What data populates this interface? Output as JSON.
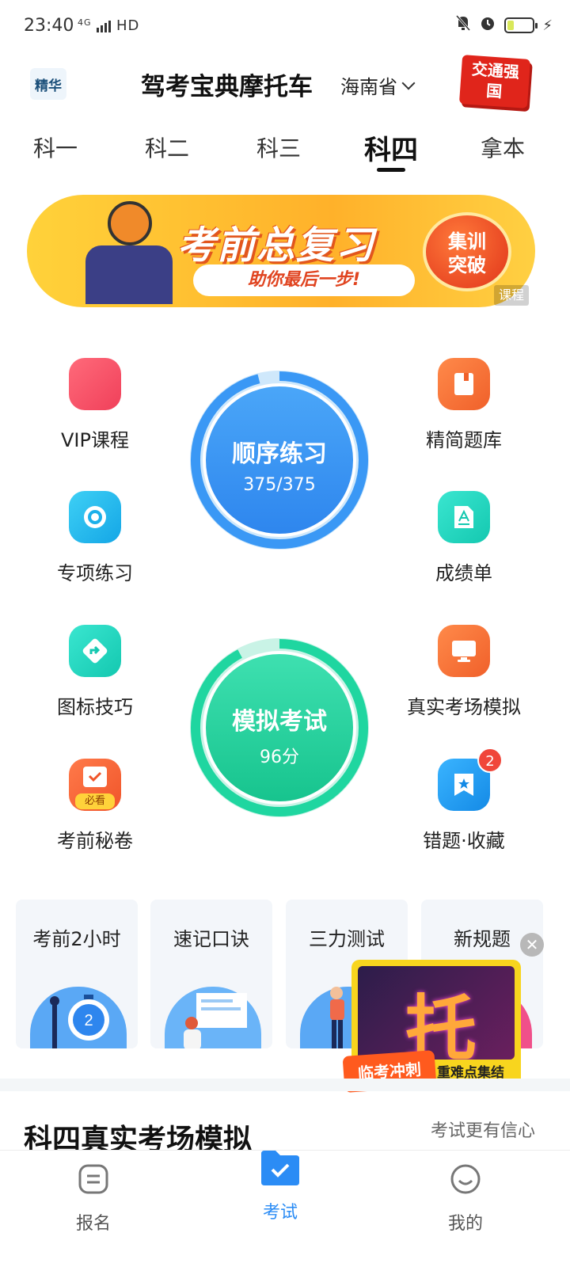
{
  "status_bar": {
    "time": "23:40",
    "network": "4G",
    "hd": "HD",
    "icons": [
      "mute-icon",
      "alarm-icon",
      "battery-icon",
      "charging-icon"
    ]
  },
  "header": {
    "logo_text": "精华",
    "title": "驾考宝典摩托车",
    "province": "海南省",
    "badge_text": "交通强国"
  },
  "tabs": [
    {
      "label": "科一",
      "active": false
    },
    {
      "label": "科二",
      "active": false
    },
    {
      "label": "科三",
      "active": false
    },
    {
      "label": "科四",
      "active": true
    },
    {
      "label": "拿本",
      "active": false
    }
  ],
  "banner": {
    "title": "考前总复习",
    "subtitle": "助你最后一步!",
    "cta": "集训突破",
    "tag": "课程"
  },
  "left_items": [
    {
      "label": "VIP课程",
      "icon": "vip-icon",
      "color": "#f04a5e"
    },
    {
      "label": "专项练习",
      "icon": "target-icon",
      "color": "#1cb0ea"
    },
    {
      "label": "图标技巧",
      "icon": "direction-sign-icon",
      "color": "#1fd6c0"
    },
    {
      "label": "考前秘卷",
      "icon": "must-see-icon",
      "color": "#f5a623",
      "sub": "必看"
    }
  ],
  "right_items": [
    {
      "label": "精简题库",
      "icon": "book-icon",
      "color": "#f5733a"
    },
    {
      "label": "成绩单",
      "icon": "scorecard-icon",
      "color": "#1fd6c0"
    },
    {
      "label": "真实考场模拟",
      "icon": "monitor-icon",
      "color": "#f5733a"
    },
    {
      "label": "错题·收藏",
      "icon": "bookmark-star-icon",
      "color": "#1c9ff0",
      "badge": "2"
    }
  ],
  "practice": {
    "title": "顺序练习",
    "progress": "375/375",
    "done": 375,
    "total": 375
  },
  "mock_exam": {
    "title": "模拟考试",
    "score": "96分",
    "score_value": 96
  },
  "cards": [
    {
      "title": "考前2小时",
      "icon": "stopwatch-icon",
      "number": "2"
    },
    {
      "title": "速记口诀",
      "icon": "study-icon"
    },
    {
      "title": "三力测试",
      "icon": "person-icon"
    },
    {
      "title": "新规题",
      "icon": "new-rules-icon"
    }
  ],
  "promo": {
    "big_char": "托",
    "tag1": "临考冲刺",
    "tag2": "重难点集结"
  },
  "section": {
    "title": "科四真实考场模拟",
    "subtitle": "考试更有信心"
  },
  "bottom_nav": [
    {
      "label": "报名",
      "icon": "signup-icon",
      "active": false
    },
    {
      "label": "考试",
      "icon": "exam-folder-icon",
      "active": true
    },
    {
      "label": "我的",
      "icon": "smile-icon",
      "active": false
    }
  ],
  "colors": {
    "accent": "#2b8cf5",
    "green": "#1fd6a0",
    "red": "#e0251b"
  }
}
